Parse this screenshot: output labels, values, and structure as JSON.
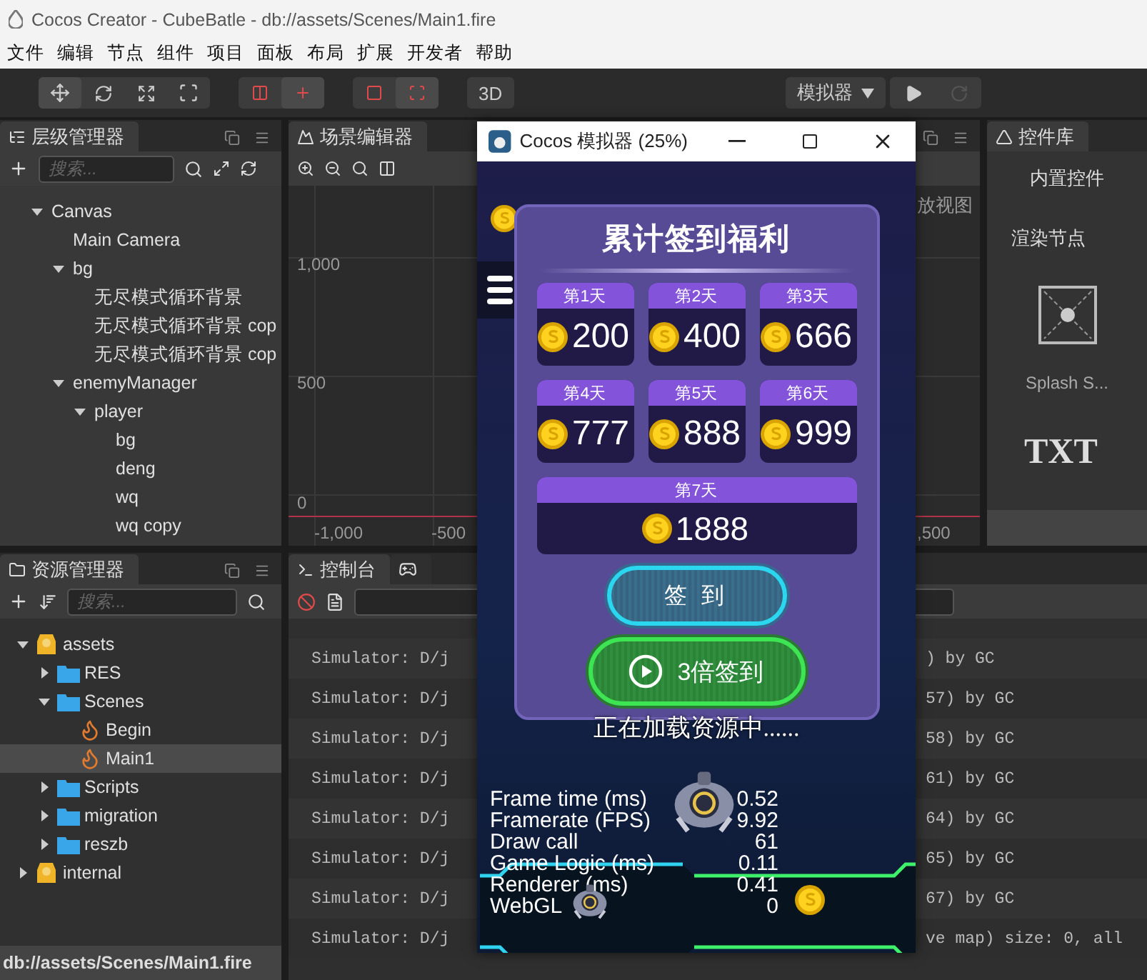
{
  "window": {
    "title": "Cocos Creator - CubeBatle - db://assets/Scenes/Main1.fire"
  },
  "menu": [
    "文件",
    "编辑",
    "节点",
    "组件",
    "项目",
    "面板",
    "布局",
    "扩展",
    "开发者",
    "帮助"
  ],
  "toolbar": {
    "view_mode": "3D",
    "preview_target": "模拟器"
  },
  "hierarchy": {
    "title": "层级管理器",
    "search_placeholder": "搜索...",
    "nodes": [
      {
        "label": "Canvas",
        "expanded": true,
        "children": [
          {
            "label": "Main Camera"
          },
          {
            "label": "bg",
            "expanded": true,
            "children": [
              {
                "label": "无尽模式循环背景"
              },
              {
                "label": "无尽模式循环背景 cop"
              },
              {
                "label": "无尽模式循环背景 cop"
              }
            ]
          },
          {
            "label": "enemyManager",
            "expanded": true,
            "children": [
              {
                "label": "player",
                "expanded": true,
                "children": [
                  {
                    "label": "bg"
                  },
                  {
                    "label": "deng"
                  },
                  {
                    "label": "wq"
                  },
                  {
                    "label": "wq copy"
                  }
                ]
              }
            ]
          }
        ]
      }
    ]
  },
  "scene_editor": {
    "title": "场景编辑器",
    "y_labels": [
      "1,000",
      "500",
      "0"
    ],
    "x_labels": [
      "-1,000",
      "-500",
      ",500"
    ],
    "hint": "放视图"
  },
  "control_library": {
    "title": "控件库",
    "section": "内置控件",
    "group": "渲染节点",
    "items": [
      {
        "label": "Splash S..."
      }
    ],
    "text_sample": "TXT"
  },
  "assets": {
    "title": "资源管理器",
    "search_placeholder": "搜索...",
    "status": "db://assets/Scenes/Main1.fire",
    "items": [
      {
        "label": "assets",
        "kind": "db",
        "expanded": true,
        "selected": false,
        "children": [
          {
            "label": "RES",
            "kind": "folder",
            "expanded": false,
            "selected": false
          },
          {
            "label": "Scenes",
            "kind": "folder",
            "expanded": true,
            "selected": false,
            "children": [
              {
                "label": "Begin",
                "kind": "scene",
                "selected": false
              },
              {
                "label": "Main1",
                "kind": "scene",
                "selected": true
              }
            ]
          },
          {
            "label": "Scripts",
            "kind": "folder",
            "expanded": false,
            "selected": false
          },
          {
            "label": "migration",
            "kind": "folder",
            "expanded": false,
            "selected": false
          },
          {
            "label": "reszb",
            "kind": "folder",
            "expanded": false,
            "selected": false
          }
        ]
      },
      {
        "label": "internal",
        "kind": "db",
        "expanded": false,
        "selected": false
      }
    ]
  },
  "console": {
    "title": "控制台",
    "rows": [
      {
        "left": "Simulator: D/j",
        "right": ") by GC"
      },
      {
        "left": "Simulator: D/j",
        "right": "57) by GC"
      },
      {
        "left": "Simulator: D/j",
        "right": "58) by GC"
      },
      {
        "left": "Simulator: D/j",
        "right": "61) by GC"
      },
      {
        "left": "Simulator: D/j",
        "right": "64) by GC"
      },
      {
        "left": "Simulator: D/j",
        "right": "65) by GC"
      },
      {
        "left": "Simulator: D/j",
        "right": "67) by GC"
      },
      {
        "left": "Simulator: D/j",
        "right": "ve map) size: 0, all"
      }
    ]
  },
  "simulator": {
    "title": "Cocos 模拟器 (25%)",
    "dialog": {
      "title": "累计签到福利",
      "days": [
        {
          "label": "第1天",
          "amount": "200"
        },
        {
          "label": "第2天",
          "amount": "400"
        },
        {
          "label": "第3天",
          "amount": "666"
        },
        {
          "label": "第4天",
          "amount": "777"
        },
        {
          "label": "第5天",
          "amount": "888"
        },
        {
          "label": "第6天",
          "amount": "999"
        },
        {
          "label": "第7天",
          "amount": "1888"
        }
      ],
      "buttons": [
        {
          "kind": "normal",
          "label": "签 到"
        },
        {
          "kind": "video",
          "label": "3倍签到"
        }
      ]
    },
    "loading_text": "正在加载资源中......",
    "stats": [
      {
        "label": "Frame time (ms)",
        "value": "0.52"
      },
      {
        "label": "Framerate (FPS)",
        "value": "9.92"
      },
      {
        "label": "Draw call",
        "value": "61"
      },
      {
        "label": "Game Logic (ms)",
        "value": "0.11"
      },
      {
        "label": "Renderer (ms)",
        "value": "0.41"
      },
      {
        "label": "WebGL",
        "value": "0"
      }
    ]
  }
}
